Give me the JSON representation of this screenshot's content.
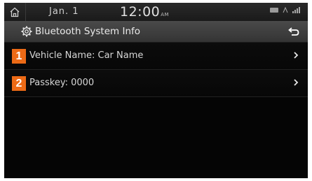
{
  "status_bar": {
    "date": "Jan.  1",
    "time": "12:00",
    "ampm": "AM"
  },
  "title_bar": {
    "title": "Bluetooth System Info"
  },
  "items": [
    {
      "badge": "1",
      "label": "Vehicle Name: Car Name"
    },
    {
      "badge": "2",
      "label": "Passkey: 0000"
    }
  ],
  "colors": {
    "badge": "#ec6a16",
    "background": "#050505"
  }
}
